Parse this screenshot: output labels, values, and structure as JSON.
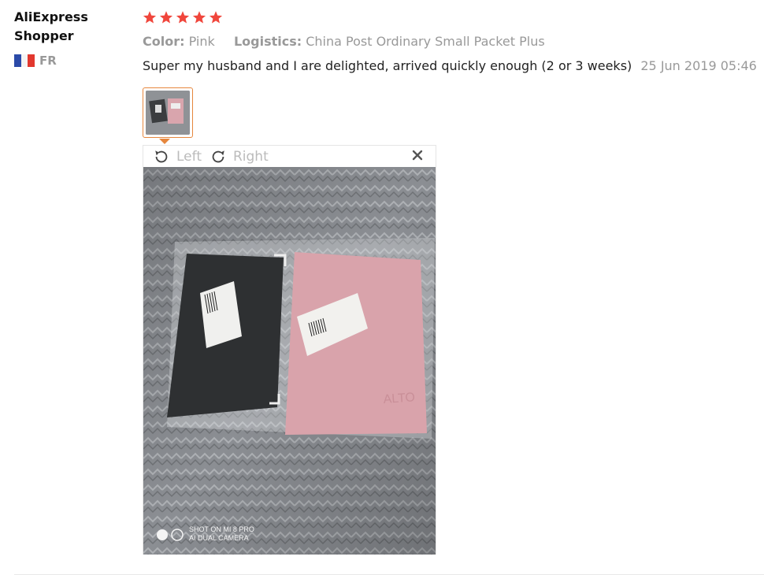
{
  "reviewer": {
    "name": "AliExpress Shopper",
    "country_code": "FR",
    "flag_icon": "france-flag-icon"
  },
  "review": {
    "rating": 5,
    "max_rating": 5,
    "star_color": "#f0463c",
    "color_label": "Color:",
    "color_value": "Pink",
    "logistics_label": "Logistics:",
    "logistics_value": "China Post Ordinary Small Packet Plus",
    "text": "Super my husband and I are delighted, arrived quickly enough (2 or 3 weeks)",
    "date": "25 Jun 2019 05:46"
  },
  "viewer": {
    "rotate_left_label": "Left",
    "rotate_right_label": "Right",
    "close_icon": "close-icon",
    "watermark_line1": "SHOT ON MI 8 PRO",
    "watermark_line2": "AI DUAL CAMERA"
  },
  "colors": {
    "accent": "#e6873d",
    "muted_text": "#999999"
  }
}
